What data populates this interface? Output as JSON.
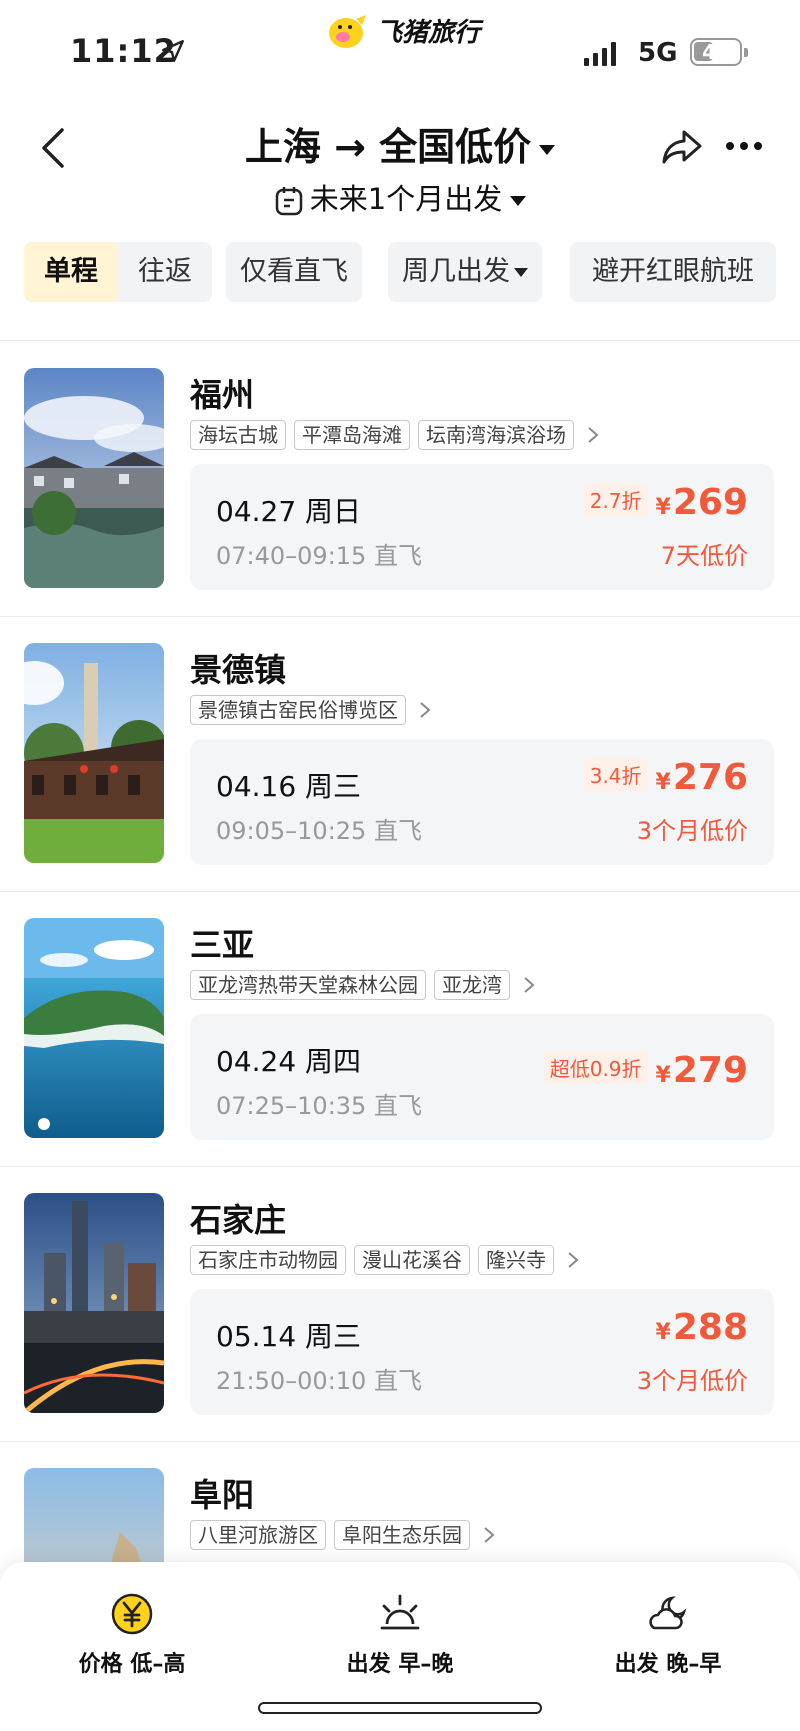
{
  "status_bar": {
    "time": "11:12",
    "network": "5G",
    "battery": "44",
    "battery_level": 0.44
  },
  "brand": {
    "name": "飞猪旅行"
  },
  "header": {
    "title": "上海 → 全国低价",
    "subtitle": "未来1个月出发"
  },
  "filters": {
    "trip_types": [
      "单程",
      "往返"
    ],
    "active_trip_type": "单程",
    "direct_only": "仅看直飞",
    "weekday": "周几出发",
    "avoid_redeye": "避开红眼航班"
  },
  "destinations": [
    {
      "city": "福州",
      "tags": [
        "海坛古城",
        "平潭岛海滩",
        "坛南湾海滨浴场"
      ],
      "date": "04.27 周日",
      "schedule": "07:40–09:15 直飞",
      "discount": "2.7折",
      "currency": "¥",
      "price": "269",
      "note": "7天低价"
    },
    {
      "city": "景德镇",
      "tags": [
        "景德镇古窑民俗博览区"
      ],
      "date": "04.16 周三",
      "schedule": "09:05–10:25 直飞",
      "discount": "3.4折",
      "currency": "¥",
      "price": "276",
      "note": "3个月低价"
    },
    {
      "city": "三亚",
      "tags": [
        "亚龙湾热带天堂森林公园",
        "亚龙湾"
      ],
      "date": "04.24 周四",
      "schedule": "07:25–10:35 直飞",
      "discount": "超低0.9折",
      "currency": "¥",
      "price": "279",
      "note": ""
    },
    {
      "city": "石家庄",
      "tags": [
        "石家庄市动物园",
        "漫山花溪谷",
        "隆兴寺"
      ],
      "date": "05.14 周三",
      "schedule": "21:50–00:10 直飞",
      "discount": "",
      "currency": "¥",
      "price": "288",
      "note": "3个月低价"
    },
    {
      "city": "阜阳",
      "tags": [
        "八里河旅游区",
        "阜阳生态乐园"
      ]
    }
  ],
  "sort_bar": [
    {
      "label": "价格 低–高",
      "icon": "yen-coin-icon"
    },
    {
      "label": "出发 早–晚",
      "icon": "sunrise-icon"
    },
    {
      "label": "出发 晚–早",
      "icon": "moon-cloud-icon"
    }
  ],
  "colors": {
    "accent_price": "#f05a3b",
    "active_tab_bg": "#fff4d4",
    "coin": "#ffd21e"
  }
}
